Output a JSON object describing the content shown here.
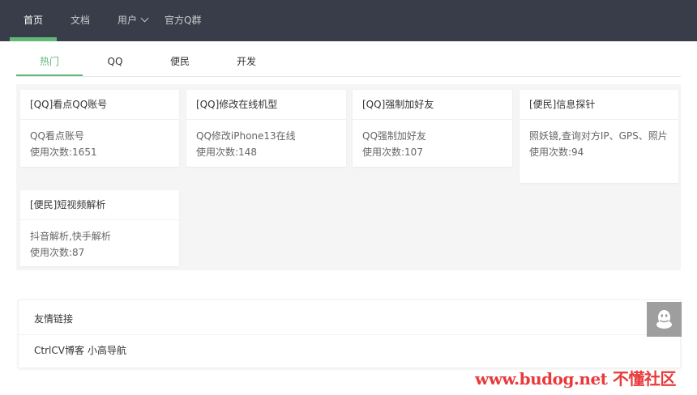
{
  "nav": {
    "items": [
      {
        "label": "首页",
        "active": true
      },
      {
        "label": "文档"
      },
      {
        "label": "用户"
      },
      {
        "label": "官方Q群"
      }
    ]
  },
  "tabs": [
    {
      "label": "热门",
      "active": true
    },
    {
      "label": "QQ"
    },
    {
      "label": "便民"
    },
    {
      "label": "开发"
    }
  ],
  "cards": [
    {
      "title": "[QQ]看点QQ账号",
      "desc": "QQ看点账号",
      "count": "使用次数:1651"
    },
    {
      "title": "[QQ]修改在线机型",
      "desc": "QQ修改iPhone13在线",
      "count": "使用次数:148"
    },
    {
      "title": "[QQ]强制加好友",
      "desc": "QQ强制加好友",
      "count": "使用次数:107"
    },
    {
      "title": "[便民]信息探针",
      "desc": "照妖镜,查询对方IP、GPS、照片",
      "count": "使用次数:94"
    },
    {
      "title": "[便民]短视频解析",
      "desc": "抖音解析,快手解析",
      "count": "使用次数:87"
    }
  ],
  "links": {
    "title": "友情链接",
    "items": [
      "CtrlCV博客",
      "小高导航"
    ]
  },
  "float_button": {
    "icon": "qq-penguin-icon"
  },
  "watermark": "www.budog.net 不懂社区",
  "colors": {
    "nav_bg": "#393d49",
    "accent": "#5fb878",
    "grid_bg": "#f5f5f5"
  }
}
